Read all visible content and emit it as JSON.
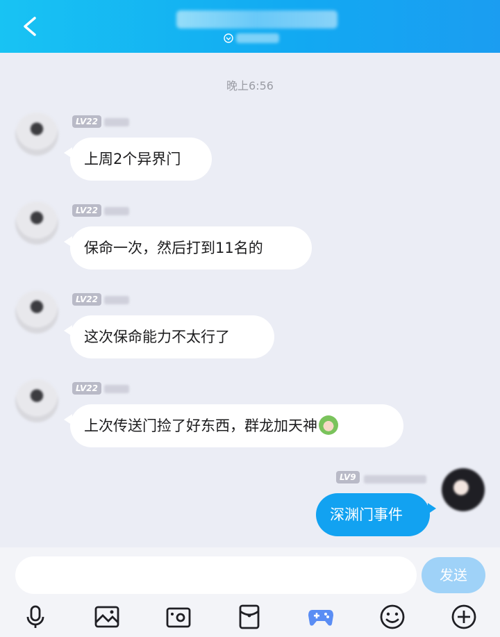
{
  "header": {
    "title": "",
    "status": ""
  },
  "timestamp": "晚上6:56",
  "messages": [
    {
      "side": "left",
      "level": "LV22",
      "text": "上周2个异界门"
    },
    {
      "side": "left",
      "level": "LV22",
      "text": "保命一次，然后打到11名的"
    },
    {
      "side": "left",
      "level": "LV22",
      "text": "这次保命能力不太行了"
    },
    {
      "side": "left",
      "level": "LV22",
      "text": "上次传送门捡了好东西，群龙加天神",
      "emoji": "green-face-emoji"
    },
    {
      "side": "right",
      "level": "LV9",
      "text": "深渊门事件"
    }
  ],
  "composer": {
    "placeholder": "",
    "send_label": "发送"
  },
  "toolbar": {
    "icons": [
      "microphone-icon",
      "image-icon",
      "camera-icon",
      "red-packet-icon",
      "gamepad-icon",
      "emoji-icon",
      "plus-icon"
    ]
  },
  "colors": {
    "header_start": "#18c3f3",
    "header_end": "#1b9df1",
    "background": "#ebedf5",
    "my_bubble": "#12a2f1",
    "send_button": "#9fd2f8",
    "game_icon": "#5a8df4"
  }
}
